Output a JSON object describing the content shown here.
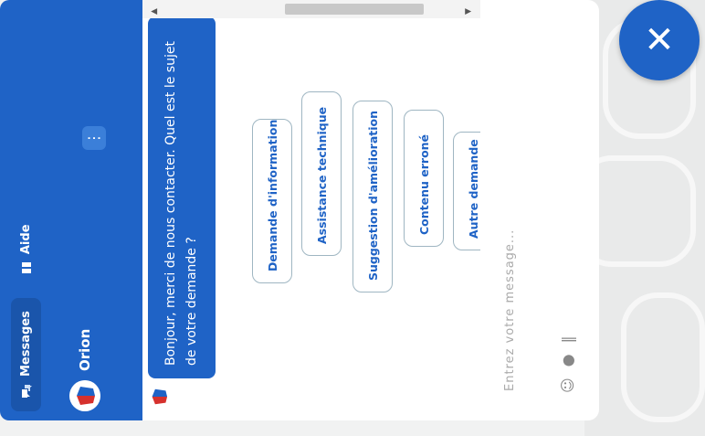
{
  "header": {
    "tabs": [
      {
        "label": "Messages",
        "icon": "chat-bubbles-icon",
        "active": true
      },
      {
        "label": "Aide",
        "icon": "book-icon",
        "active": false
      }
    ],
    "agent_name": "Orion",
    "more_label": "⋮"
  },
  "conversation": {
    "bot_message": "Bonjour, merci de nous contacter. Quel est le sujet de votre demande ?",
    "choices": [
      "Demande d'information",
      "Assistance technique",
      "Suggestion d'amélioration",
      "Contenu erroné",
      "Autre demande"
    ]
  },
  "composer": {
    "placeholder": "Entrez votre message..."
  },
  "close_button": {
    "label": "✕"
  },
  "colors": {
    "brand": "#1f63c6",
    "choice_border": "#9fb6c2",
    "choice_text": "#1f63c6"
  }
}
